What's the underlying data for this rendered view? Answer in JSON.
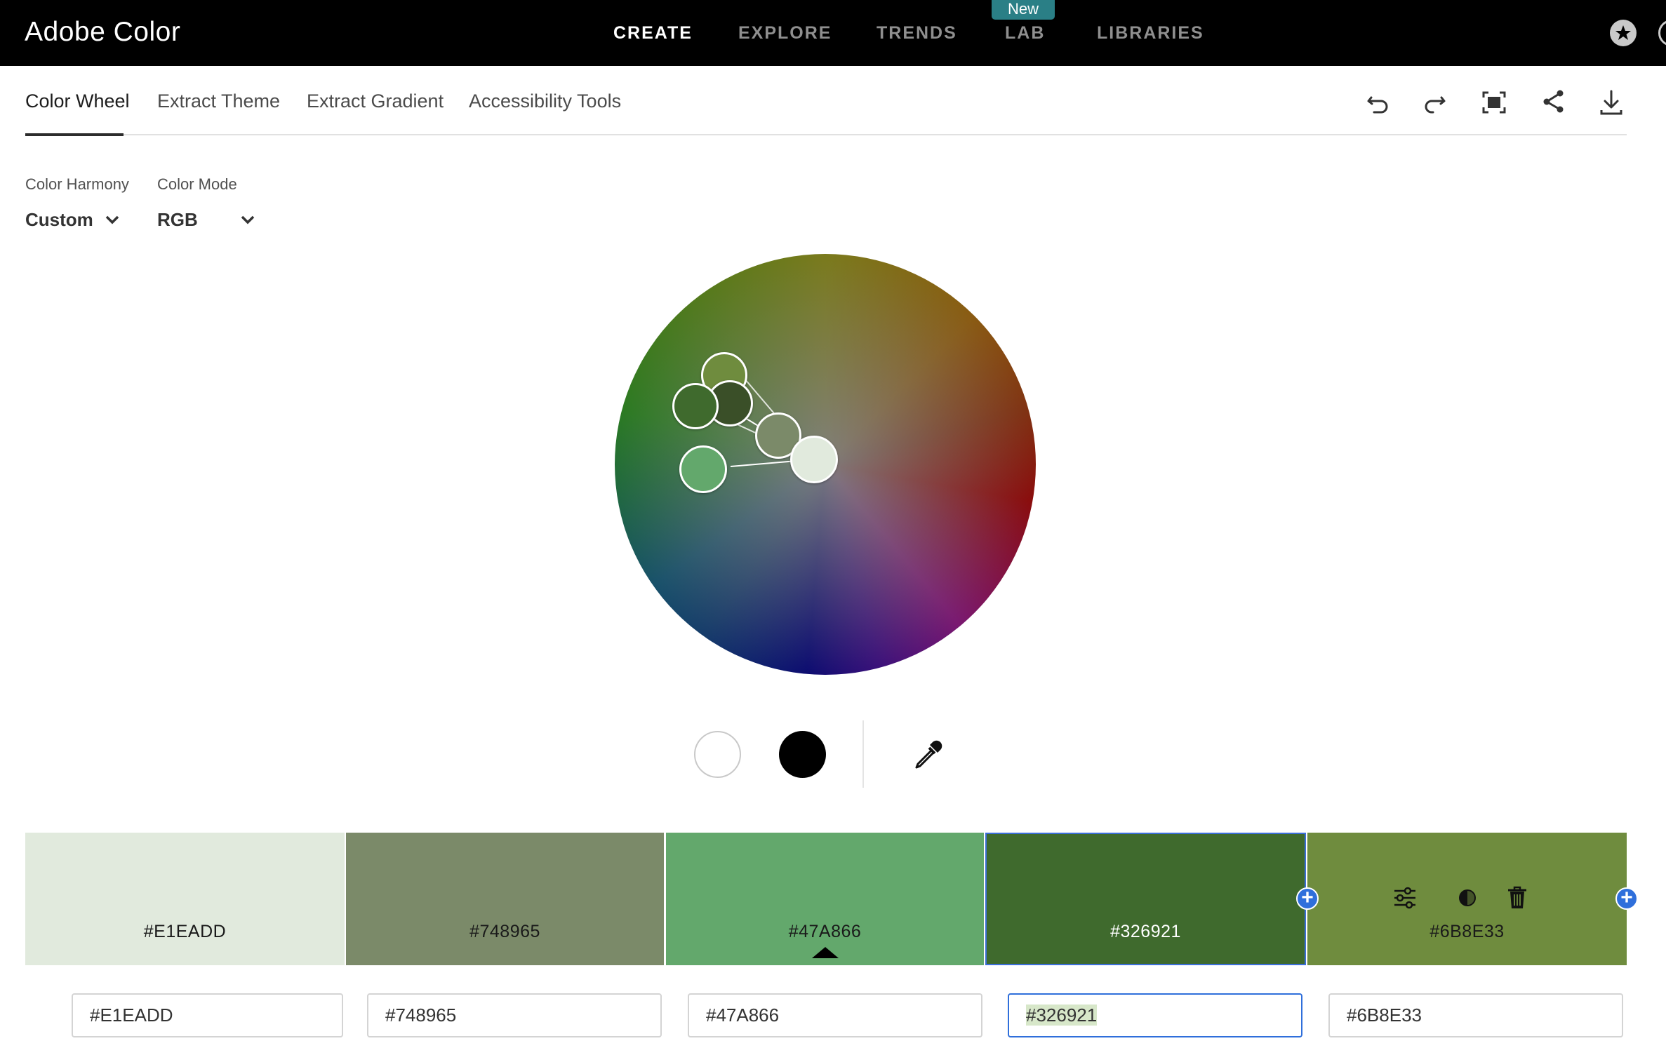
{
  "header": {
    "brand": "Adobe Color",
    "nav": [
      {
        "label": "CREATE",
        "active": true
      },
      {
        "label": "EXPLORE",
        "active": false
      },
      {
        "label": "TRENDS",
        "active": false
      },
      {
        "label": "LAB",
        "active": false
      },
      {
        "label": "LIBRARIES",
        "active": false
      }
    ],
    "badge": "New"
  },
  "tabs": [
    {
      "label": "Color Wheel",
      "active": true
    },
    {
      "label": "Extract Theme",
      "active": false
    },
    {
      "label": "Extract Gradient",
      "active": false
    },
    {
      "label": "Accessibility Tools",
      "active": false
    }
  ],
  "toolbar": {
    "icons": [
      "undo-icon",
      "redo-icon",
      "fullscreen-icon",
      "share-icon",
      "download-icon"
    ]
  },
  "controls": {
    "harmony_label": "Color Harmony",
    "harmony_value": "Custom",
    "mode_label": "Color Mode",
    "mode_value": "RGB"
  },
  "swatches": [
    {
      "hex": "#E1EADD",
      "color": "#E1EADD",
      "text_color": "#1a1a1a"
    },
    {
      "hex": "#748965",
      "color": "#7B8A69",
      "text_color": "#1a1a1a"
    },
    {
      "hex": "#47A866",
      "color": "#63A86C",
      "text_color": "#1a1a1a",
      "base": true
    },
    {
      "hex": "#326921",
      "color": "#3F6A2D",
      "text_color": "#ffffff",
      "selected": true
    },
    {
      "hex": "#6B8E33",
      "color": "#6F8C3E",
      "text_color": "#1a1a1a"
    }
  ],
  "inputs": [
    {
      "value": "#E1EADD"
    },
    {
      "value": "#748965"
    },
    {
      "value": "#47A866"
    },
    {
      "value": "#326921",
      "focused": true
    },
    {
      "value": "#6B8E33"
    }
  ]
}
